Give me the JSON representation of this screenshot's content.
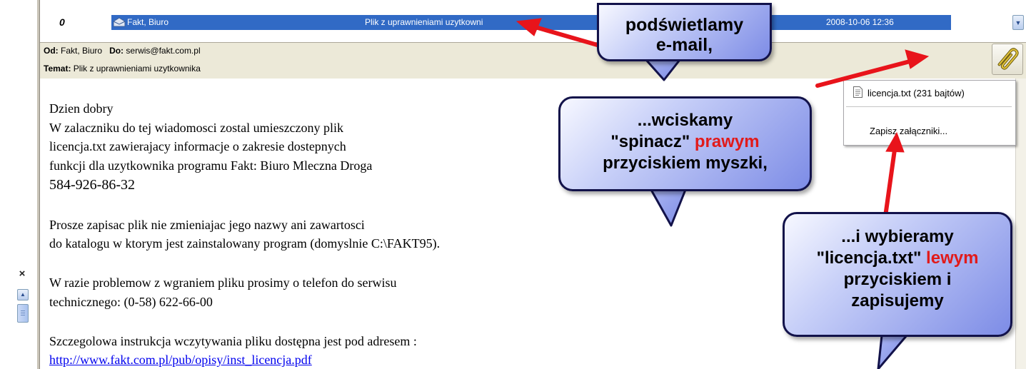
{
  "left_panel": {
    "close_glyph": "×"
  },
  "message_row": {
    "sender": "Fakt, Biuro",
    "subject": "Plik z uprawnieniami uzytkowni",
    "date": "2008-10-06 12:36"
  },
  "header": {
    "from_label": "Od:",
    "from_value": "Fakt, Biuro",
    "to_label": "Do:",
    "to_value": "serwis@fakt.com.pl",
    "subject_label": "Temat:",
    "subject_value": "Plik z uprawnieniami uzytkownika"
  },
  "body": {
    "lines": [
      "Dzien dobry",
      "W zalaczniku do tej wiadomosci zostal umieszczony plik",
      "licencja.txt zawierajacy informacje o zakresie dostepnych",
      "funkcji dla uzytkownika programu Fakt: Biuro Mleczna Droga",
      " 584-926-86-32",
      "Prosze zapisac plik nie zmieniajac jego nazwy ani zawartosci",
      "do katalogu w ktorym jest zainstalowany program (domyslnie C:\\FAKT95).",
      "W razie problemow z wgraniem pliku prosimy o telefon do serwisu",
      "technicznego: (0-58) 622-66-00",
      "Szczegolowa instrukcja wczytywania pliku dostępna jest pod adresem :"
    ],
    "link": "http://www.fakt.com.pl/pub/opisy/inst_licencja.pdf"
  },
  "context_menu": {
    "file_item": "licencja.txt (231 bajtów)",
    "save_item": "Zapisz załączniki..."
  },
  "callouts": {
    "c1_line1": "podświetlamy",
    "c1_line2": "e-mail,",
    "c2_line1": "...wciskamy",
    "c2_line2a": "\"spinacz\" ",
    "c2_line2b": "prawym",
    "c2_line3": "przyciskiem myszki,",
    "c3_line1": "...i wybieramy",
    "c3_line2a": "\"licencja.txt\" ",
    "c3_line2b": "lewym",
    "c3_line3": "przyciskiem i",
    "c3_line4": "zapisujemy"
  },
  "colors": {
    "selection": "#316ac5",
    "arrow": "#e8141b",
    "callout_border": "#12124a",
    "link": "#0000ee"
  },
  "icons": [
    "attachment-column-icon",
    "envelope-icon",
    "paperclip-icon",
    "text-file-icon",
    "close-icon",
    "scroll-up-icon"
  ]
}
